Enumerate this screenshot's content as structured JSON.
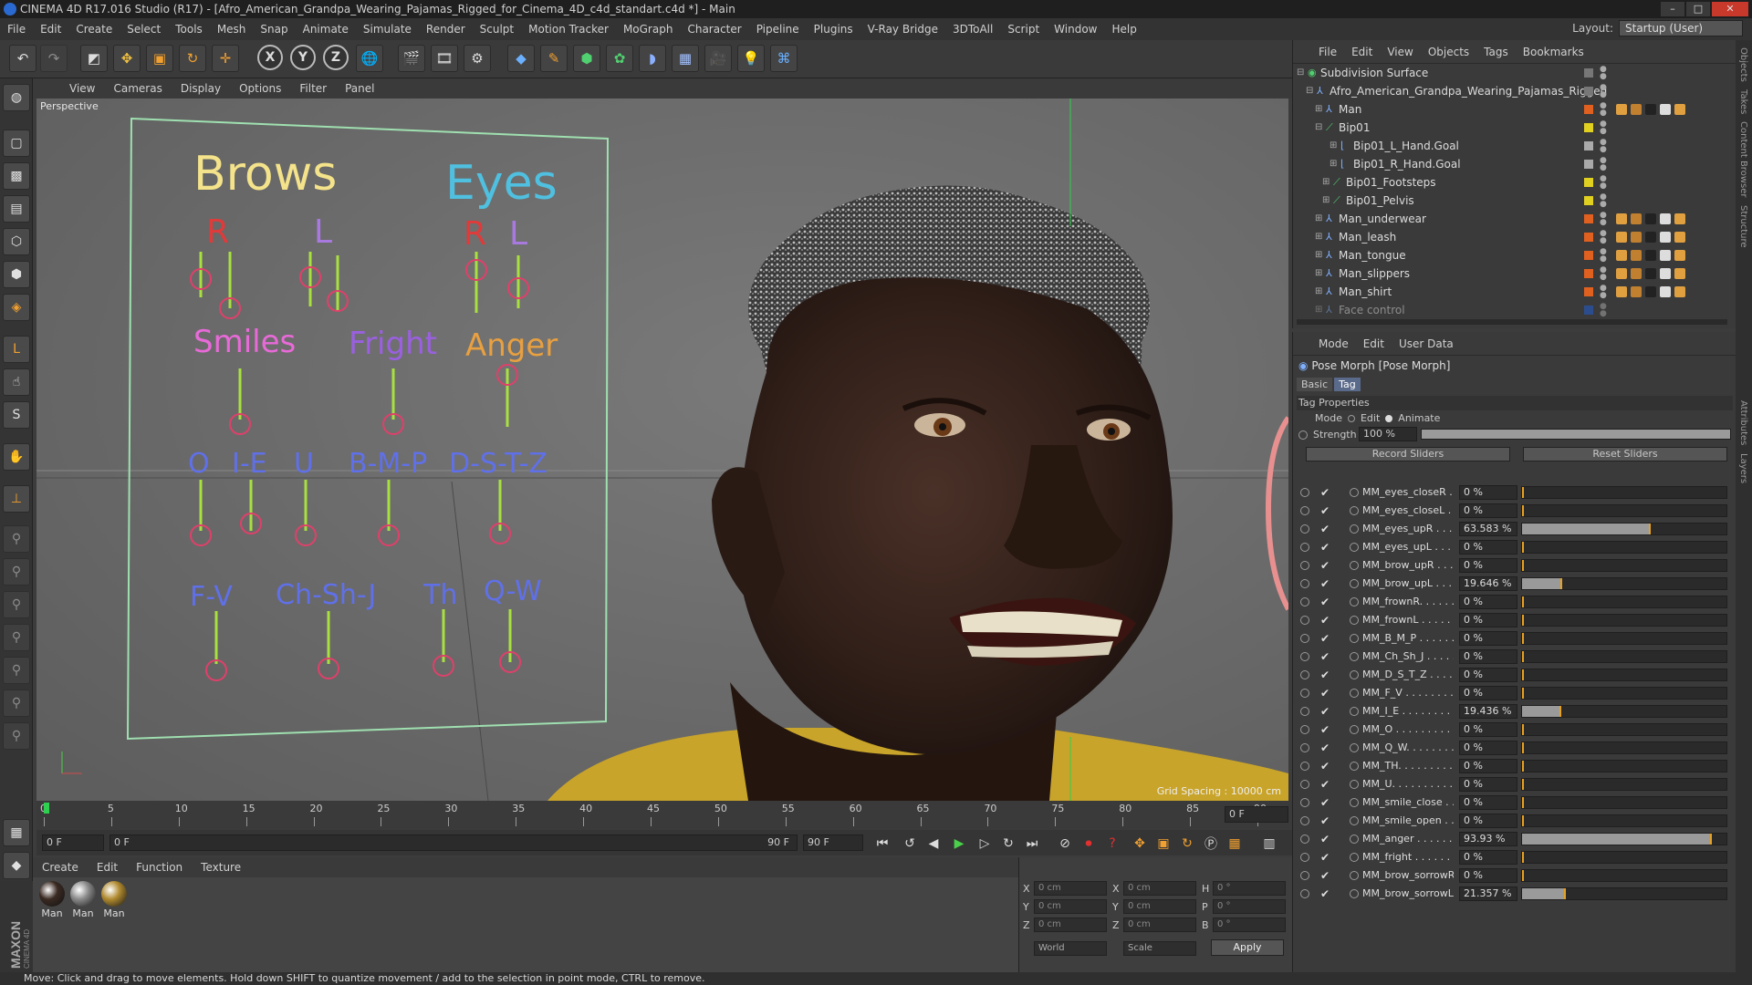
{
  "window": {
    "title": "CINEMA 4D R17.016 Studio (R17) - [Afro_American_Grandpa_Wearing_Pajamas_Rigged_for_Cinema_4D_c4d_standart.c4d *] - Main",
    "layout_label": "Layout:",
    "layout_value": "Startup (User)"
  },
  "menu": [
    "File",
    "Edit",
    "Create",
    "Select",
    "Tools",
    "Mesh",
    "Snap",
    "Animate",
    "Simulate",
    "Render",
    "Sculpt",
    "Motion Tracker",
    "MoGraph",
    "Character",
    "Pipeline",
    "Plugins",
    "V-Ray Bridge",
    "3DToAll",
    "Script",
    "Window",
    "Help"
  ],
  "viewport": {
    "menu": [
      "View",
      "Cameras",
      "Display",
      "Options",
      "Filter",
      "Panel"
    ],
    "label": "Perspective",
    "grid_spacing": "Grid Spacing : 10000 cm",
    "board": {
      "brows": "Brows",
      "brows_r": "R",
      "brows_l": "L",
      "eyes": "Eyes",
      "eyes_r": "R",
      "eyes_l": "L",
      "smiles": "Smiles",
      "fright": "Fright",
      "anger": "Anger",
      "o": "O",
      "ie": "I-E",
      "u": "U",
      "bmp": "B-M-P",
      "dstz": "D-S-T-Z",
      "fv": "F-V",
      "chshj": "Ch-Sh-J",
      "th": "Th",
      "qw": "Q-W"
    }
  },
  "timeline": {
    "ticks": [
      "0",
      "5",
      "10",
      "15",
      "20",
      "25",
      "30",
      "35",
      "40",
      "45",
      "50",
      "55",
      "60",
      "65",
      "70",
      "75",
      "80",
      "85",
      "90"
    ],
    "current_frame": "0 F",
    "start_frame": "0 F",
    "range_start": "0 F",
    "range_end": "90 F",
    "end_frame": "90 F",
    "frame_right": "0 F"
  },
  "materials": {
    "menu": [
      "Create",
      "Edit",
      "Function",
      "Texture"
    ],
    "items": [
      {
        "label": "Man",
        "color": "#3a2a22"
      },
      {
        "label": "Man",
        "color": "#8a8a8a"
      },
      {
        "label": "Man",
        "color": "#b08a30"
      }
    ]
  },
  "coords": {
    "x_label": "X",
    "y_label": "Y",
    "z_label": "Z",
    "h_label": "H",
    "p_label": "P",
    "b_label": "B",
    "pos_x": "0 cm",
    "pos_y": "0 cm",
    "pos_z": "0 cm",
    "size_x": "0 cm",
    "size_y": "0 cm",
    "size_z": "0 cm",
    "rot_h": "0 °",
    "rot_p": "0 °",
    "rot_b": "0 °",
    "world": "World",
    "scale": "Scale",
    "apply": "Apply"
  },
  "status": "Move: Click and drag to move elements. Hold down SHIFT to quantize movement / add to the selection in point mode, CTRL to remove.",
  "objects": {
    "menu": [
      "File",
      "Edit",
      "View",
      "Objects",
      "Tags",
      "Bookmarks"
    ],
    "rows": [
      {
        "name": "Subdivision Surface"
      },
      {
        "name": "Afro_American_Grandpa_Wearing_Pajamas_Rigged"
      },
      {
        "name": "Man"
      },
      {
        "name": "Bip01"
      },
      {
        "name": "Bip01_L_Hand.Goal"
      },
      {
        "name": "Bip01_R_Hand.Goal"
      },
      {
        "name": "Bip01_Footsteps"
      },
      {
        "name": "Bip01_Pelvis"
      },
      {
        "name": "Man_underwear"
      },
      {
        "name": "Man_leash"
      },
      {
        "name": "Man_tongue"
      },
      {
        "name": "Man_slippers"
      },
      {
        "name": "Man_shirt"
      },
      {
        "name": "Face control"
      }
    ]
  },
  "attributes": {
    "menu": [
      "Mode",
      "Edit",
      "User Data"
    ],
    "header": "Pose Morph [Pose Morph]",
    "tabs": [
      "Basic",
      "Tag"
    ],
    "section": "Tag Properties",
    "mode_label": "Mode",
    "mode_edit": "Edit",
    "mode_animate": "Animate",
    "strength_label": "Strength",
    "strength_value": "100 %",
    "strength_fraction": 1.0,
    "record_button": "Record Sliders",
    "reset_button": "Reset Sliders",
    "sliders": [
      {
        "name": "MM_eyes_closeR . . .",
        "value": "0 %",
        "fraction": 0
      },
      {
        "name": "MM_eyes_closeL . . .",
        "value": "0 %",
        "fraction": 0
      },
      {
        "name": "MM_eyes_upR . . . . .",
        "value": "63.583 %",
        "fraction": 0.636
      },
      {
        "name": "MM_eyes_upL . . . . .",
        "value": "0 %",
        "fraction": 0
      },
      {
        "name": "MM_brow_upR . . . .",
        "value": "0 %",
        "fraction": 0
      },
      {
        "name": "MM_brow_upL . . . .",
        "value": "19.646 %",
        "fraction": 0.196
      },
      {
        "name": "MM_frownR. . . . . .",
        "value": "0 %",
        "fraction": 0
      },
      {
        "name": "MM_frownL . . . . . .",
        "value": "0 %",
        "fraction": 0
      },
      {
        "name": "MM_B_M_P . . . . . .",
        "value": "0 %",
        "fraction": 0
      },
      {
        "name": "MM_Ch_Sh_J . . . . .",
        "value": "0 %",
        "fraction": 0
      },
      {
        "name": "MM_D_S_T_Z . . . . .",
        "value": "0 %",
        "fraction": 0
      },
      {
        "name": "MM_F_V . . . . . . . .",
        "value": "0 %",
        "fraction": 0
      },
      {
        "name": "MM_I_E . . . . . . . . .",
        "value": "19.436 %",
        "fraction": 0.194
      },
      {
        "name": "MM_O . . . . . . . . . .",
        "value": "0 %",
        "fraction": 0
      },
      {
        "name": "MM_Q_W. . . . . . . .",
        "value": "0 %",
        "fraction": 0
      },
      {
        "name": "MM_TH. . . . . . . . .",
        "value": "0 %",
        "fraction": 0
      },
      {
        "name": "MM_U. . . . . . . . . .",
        "value": "0 %",
        "fraction": 0
      },
      {
        "name": "MM_smile_close . . .",
        "value": "0 %",
        "fraction": 0
      },
      {
        "name": "MM_smile_open . . .",
        "value": "0 %",
        "fraction": 0
      },
      {
        "name": "MM_anger . . . . . . .",
        "value": "93.93 %",
        "fraction": 0.939
      },
      {
        "name": "MM_fright . . . . . . .",
        "value": "0 %",
        "fraction": 0
      },
      {
        "name": "MM_brow_sorrowR . .",
        "value": "0 %",
        "fraction": 0
      },
      {
        "name": "MM_brow_sorrowL",
        "value": "21.357 %",
        "fraction": 0.214
      }
    ]
  },
  "side_tabs": [
    "Objects",
    "Takes",
    "Content Browser",
    "Structure"
  ],
  "attr_side_tabs": [
    "Attributes",
    "Layers"
  ],
  "colors": {
    "accent": "#e8a020",
    "timeline_marker": "#2fd04f"
  }
}
